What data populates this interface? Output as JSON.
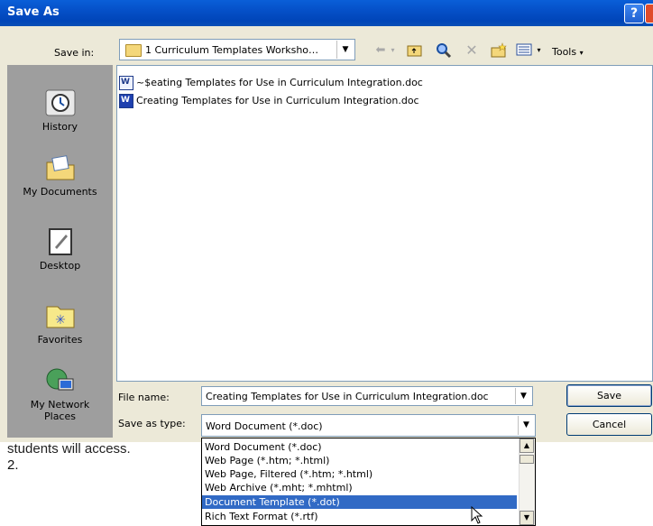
{
  "window": {
    "title": "Save As",
    "help_label": "?"
  },
  "toolbar": {
    "save_in_label": "Save in:",
    "save_in_value": "1 Curriculum Templates Worksho…",
    "tools_label": "Tools"
  },
  "places": [
    {
      "label": "History",
      "icon": "history-icon"
    },
    {
      "label": "My Documents",
      "icon": "my-documents-icon"
    },
    {
      "label": "Desktop",
      "icon": "desktop-icon"
    },
    {
      "label": "Favorites",
      "icon": "favorites-icon"
    },
    {
      "label_line1": "My Network",
      "label_line2": "Places",
      "icon": "network-places-icon"
    }
  ],
  "files": [
    {
      "name": "~$eating Templates for Use in Curriculum Integration.doc"
    },
    {
      "name": "Creating Templates for Use in Curriculum Integration.doc"
    }
  ],
  "form": {
    "file_name_label": "File name:",
    "file_name_value": "Creating Templates for Use in Curriculum Integration.doc",
    "save_as_type_label": "Save as type:",
    "save_as_type_value": "Word Document (*.doc)",
    "save_button": "Save",
    "cancel_button": "Cancel"
  },
  "type_options": [
    "Word Document (*.doc)",
    "Web Page (*.htm; *.html)",
    "Web Page, Filtered (*.htm; *.html)",
    "Web Archive (*.mht; *.mhtml)",
    "Document Template (*.dot)",
    "Rich Text Format (*.rtf)"
  ],
  "selected_type": "Document Template (*.dot)",
  "background": {
    "partial_text": "students will access.",
    "list_number": "2."
  },
  "colors": {
    "title_bar": "#0550c8",
    "selection": "#316ac5",
    "dialog_bg": "#ece9d8",
    "places_bg": "#9e9e9e"
  }
}
